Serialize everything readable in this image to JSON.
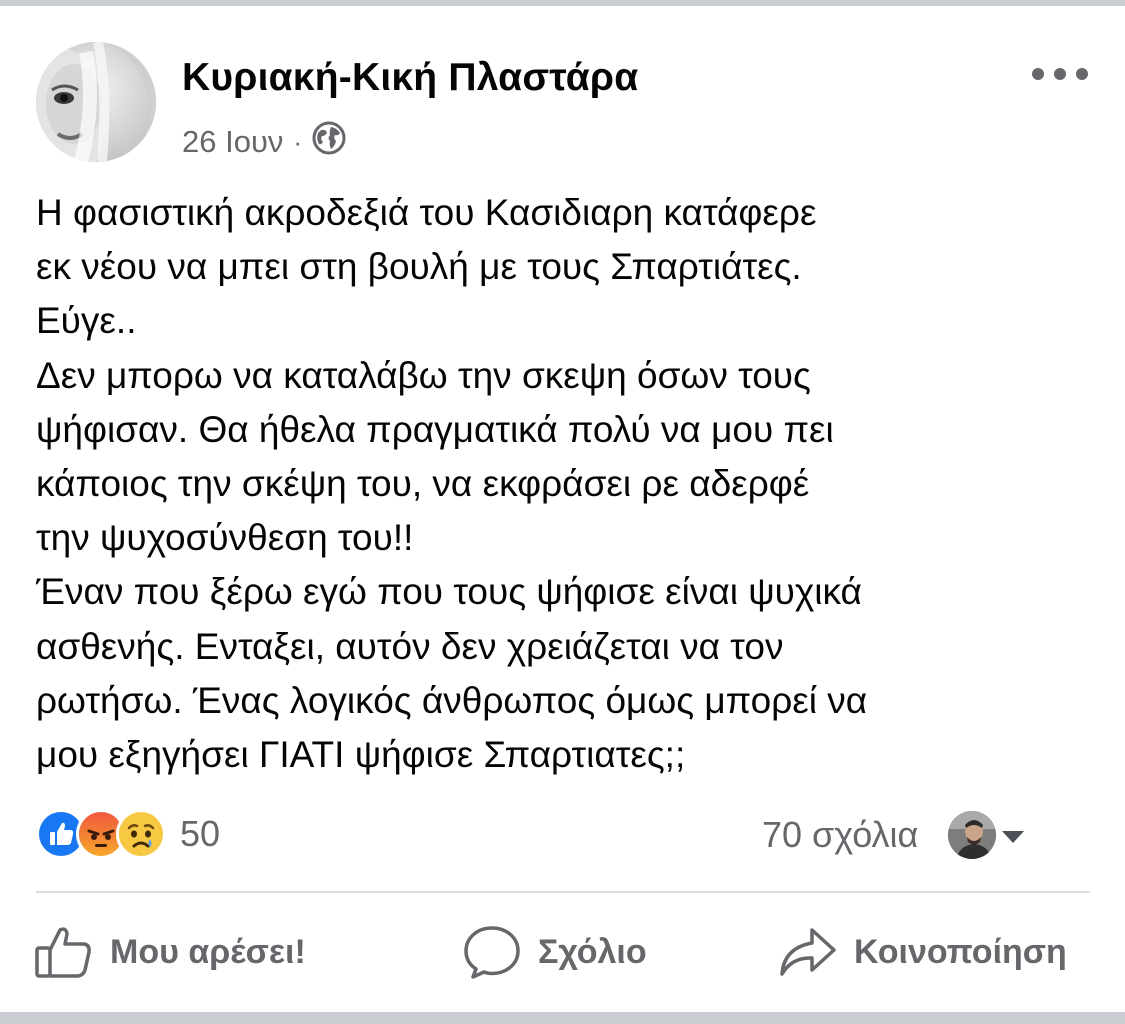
{
  "post": {
    "author": "Κυριακή-Κική Πλαστάρα",
    "date": "26 Ιουν",
    "separator": "·",
    "audience_icon": "globe-icon",
    "menu_icon": "more-options-icon",
    "body_lines": [
      "Η φασιστική ακροδεξιά του Κασιδιαρη κατάφερε",
      "εκ νέου να μπει στη βουλή με τους Σπαρτιάτες.",
      "Εύγε..",
      "Δεν μπορω να καταλάβω την σκεψη όσων τους",
      "ψήφισαν. Θα ήθελα πραγματικά πολύ να μου πει",
      "κάποιος την σκέψη του, να εκφράσει ρε αδερφέ",
      "την ψυχοσύνθεση του!!",
      "Έναν που ξέρω εγώ που τους ψήφισε είναι ψυχικά",
      "ασθενής. Ενταξει, αυτόν δεν χρειάζεται να τον",
      "ρωτήσω. Ένας λογικός άνθρωπος όμως μπορεί να",
      "μου εξηγήσει ΓΙΑΤΙ ψήφισε Σπαρτιατες;;"
    ]
  },
  "reactions": {
    "types": [
      "like",
      "angry",
      "sad"
    ],
    "count": "50"
  },
  "comments": {
    "count_label": "70 σχόλια"
  },
  "actions": {
    "like": "Μου αρέσει!",
    "comment": "Σχόλιο",
    "share": "Κοινοποίηση"
  },
  "colors": {
    "like_blue": "#1877f2",
    "angry_top": "#f0573f",
    "angry_bottom": "#f6a72b",
    "sad_yellow": "#f7c842",
    "text_secondary": "#65676b",
    "divider": "#dadde1"
  }
}
